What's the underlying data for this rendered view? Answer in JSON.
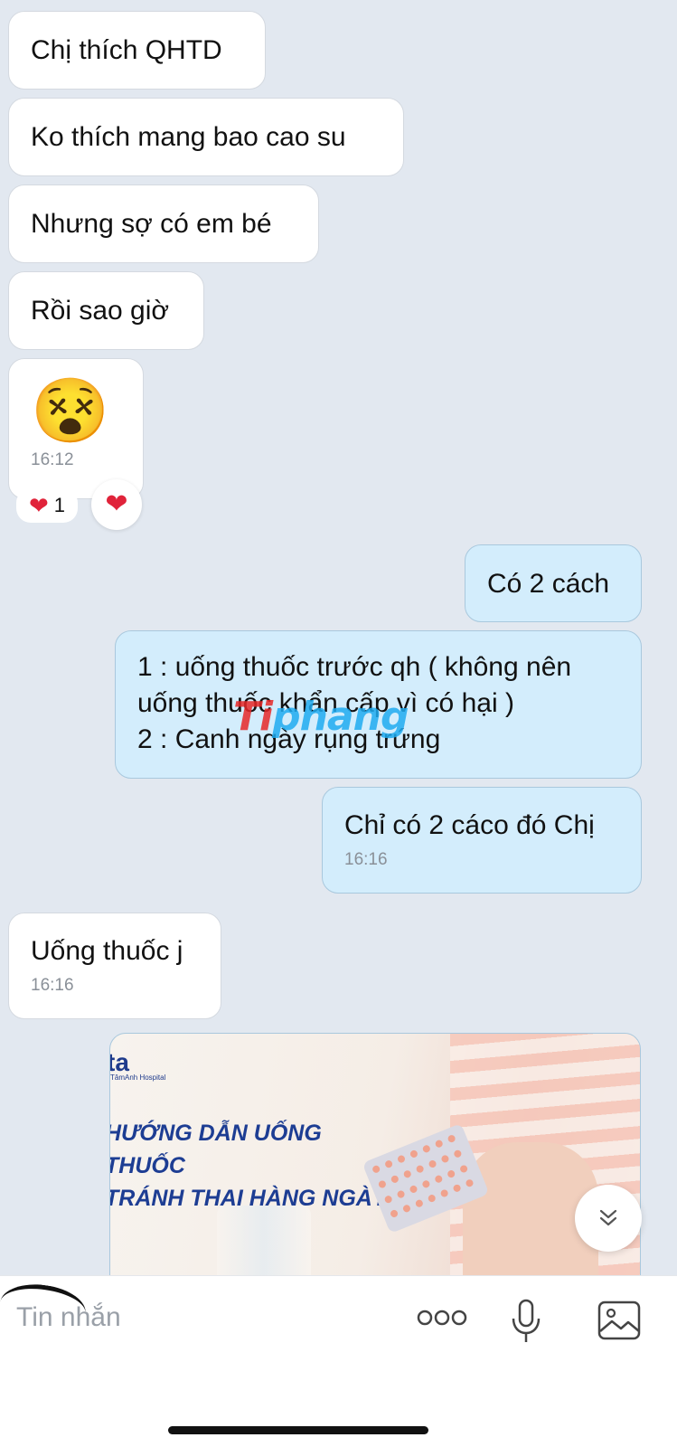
{
  "messages": {
    "m1": "Chị thích QHTD",
    "m2": "Ko thích mang bao cao su",
    "m3": "Nhưng sợ có em bé",
    "m4": "Rồi sao giờ",
    "m5_emoji": "😵",
    "m5_time": "16:12",
    "reaction_count": "1",
    "reaction_emoji": "❤",
    "o1": "Có 2 cách",
    "o2": "1 : uống thuốc trước qh ( không nên\nuống thuốc khẩn cấp vì có hại )\n2 : Canh ngày rụng trứng",
    "o3": "Chỉ có 2 cáco đó Chị",
    "o3_time": "16:16",
    "m6": "Uống thuốc j",
    "m6_time": "16:16"
  },
  "watermark": {
    "part1": "Ti",
    "part2": "phang"
  },
  "card": {
    "logo": "ta",
    "logo_sub": "TâmAnh Hospital",
    "title": "HƯỚNG DẪN UỐNG THUỐC\nTRÁNH THAI HÀNG NGÀY"
  },
  "composer": {
    "placeholder": "Tin nhắn"
  },
  "icons": {
    "more": "ellipsis-icon",
    "mic": "microphone-icon",
    "image": "image-icon",
    "scroll": "chevron-double-down-icon"
  }
}
